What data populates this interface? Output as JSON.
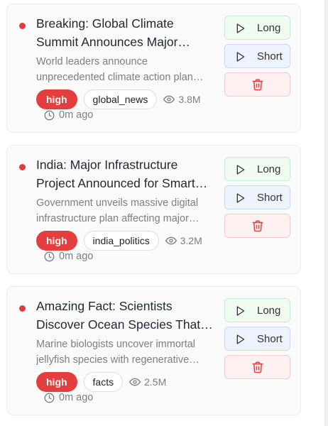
{
  "cards": [
    {
      "title": "Breaking: Global Climate Summit Announces Major Agreement",
      "description": "World leaders announce unprecedented climate action plan with binding targets",
      "priority": "high",
      "category": "global_news",
      "views": "3.8M",
      "time": "0m ago"
    },
    {
      "title": "India: Major Infrastructure Project Announced for Smart Cities",
      "description": "Government unveils massive digital infrastructure plan affecting major cities",
      "priority": "high",
      "category": "india_politics",
      "views": "3.2M",
      "time": "0m ago"
    },
    {
      "title": "Amazing Fact: Scientists Discover Ocean Species That Never Ages",
      "description": "Marine biologists uncover immortal jellyfish species with regenerative abilities",
      "priority": "high",
      "category": "facts",
      "views": "2.5M",
      "time": "0m ago"
    }
  ],
  "buttons": {
    "long_label": "Long",
    "short_label": "Short"
  },
  "colors": {
    "priority_high": "#e53e3e",
    "long_bg": "#f0fbf2",
    "short_bg": "#eef4fe",
    "delete_bg": "#fdf1f1",
    "delete_icon": "#e53e3e"
  },
  "icons": {
    "play": "play-icon",
    "delete": "trash-icon",
    "views": "eye-icon",
    "time": "clock-icon"
  }
}
